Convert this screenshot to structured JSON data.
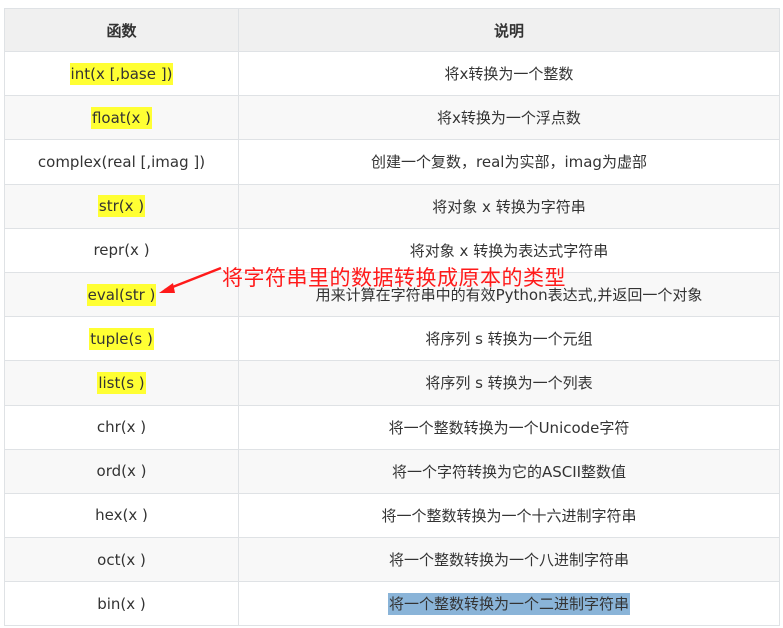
{
  "header": {
    "col1": "函数",
    "col2": "说明"
  },
  "rows": [
    {
      "func": "int(x [,base ])",
      "desc": "将x转换为一个整数",
      "highlight": true
    },
    {
      "func": "float(x )",
      "desc": "将x转换为一个浮点数",
      "highlight": true
    },
    {
      "func": "complex(real [,imag ])",
      "desc": "创建一个复数，real为实部，imag为虚部",
      "highlight": false
    },
    {
      "func": "str(x )",
      "desc": "将对象 x 转换为字符串",
      "highlight": true
    },
    {
      "func": "repr(x )",
      "desc": "将对象 x 转换为表达式字符串",
      "highlight": false
    },
    {
      "func": "eval(str )",
      "desc": "用来计算在字符串中的有效Python表达式,并返回一个对象",
      "highlight": true
    },
    {
      "func": "tuple(s )",
      "desc": "将序列 s 转换为一个元组",
      "highlight": true
    },
    {
      "func": "list(s )",
      "desc": "将序列 s 转换为一个列表",
      "highlight": true
    },
    {
      "func": "chr(x )",
      "desc": "将一个整数转换为一个Unicode字符",
      "highlight": false
    },
    {
      "func": "ord(x )",
      "desc": "将一个字符转换为它的ASCII整数值",
      "highlight": false
    },
    {
      "func": "hex(x )",
      "desc": "将一个整数转换为一个十六进制字符串",
      "highlight": false
    },
    {
      "func": "oct(x )",
      "desc": "将一个整数转换为一个八进制字符串",
      "highlight": false
    },
    {
      "func": "bin(x )",
      "desc": "将一个整数转换为一个二进制字符串",
      "highlight": false,
      "selected": true
    }
  ],
  "annotation": {
    "text": "将字符串里的数据转换成原本的类型",
    "color": "#ff1a1a"
  },
  "colors": {
    "highlight": "#ffff33",
    "selection": "#8ab4d8",
    "header_bg": "#f0f0f0",
    "border": "#dfe2e5"
  }
}
